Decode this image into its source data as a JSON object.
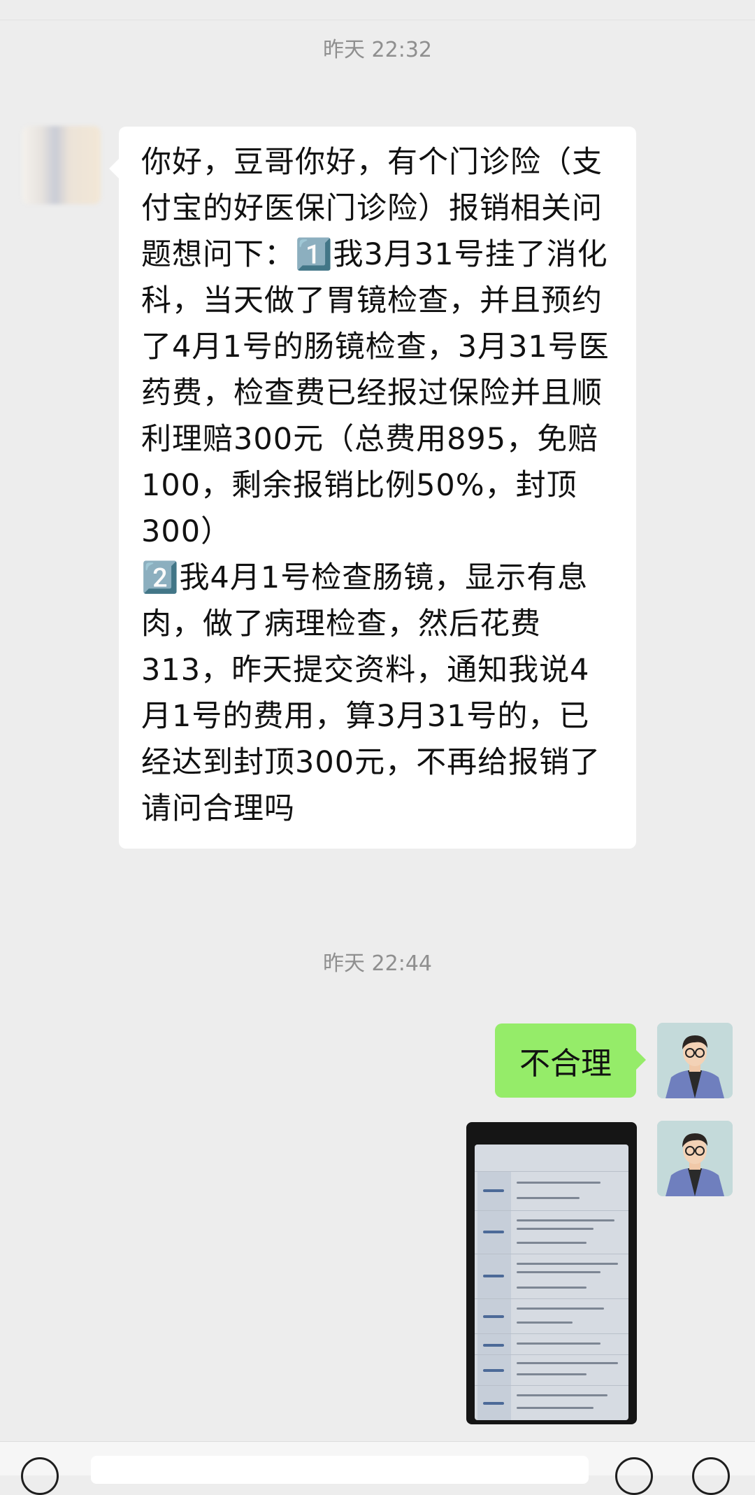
{
  "chat": {
    "time_1": "昨天 22:32",
    "received_message": "你好，豆哥你好，有个门诊险（支付宝的好医保门诊险）报销相关问题想问下：1️⃣我3月31号挂了消化科，当天做了胃镜检查，并且预约了4月1号的肠镜检查，3月31号医药费，检查费已经报过保险并且顺利理赔300元（总费用895，免赔100，剩余报销比例50%，封顶300）\n2️⃣我4月1号检查肠镜，显示有息肉，做了病理检查，然后花费313，昨天提交资料，通知我说4月1号的费用，算3月31号的，已经达到封顶300元，不再给报销了\n请问合理吗",
    "time_2": "昨天 22:44",
    "sent_message": "不合理"
  },
  "colors": {
    "background": "#ededed",
    "received_bubble": "#ffffff",
    "sent_bubble": "#95ec69",
    "timestamp": "#8f8f8f"
  },
  "icons": {
    "left_avatar": "blurred-avatar",
    "right_avatar": "cartoon-man-avatar",
    "photo": "insurance-terms-screenshot-photo"
  }
}
